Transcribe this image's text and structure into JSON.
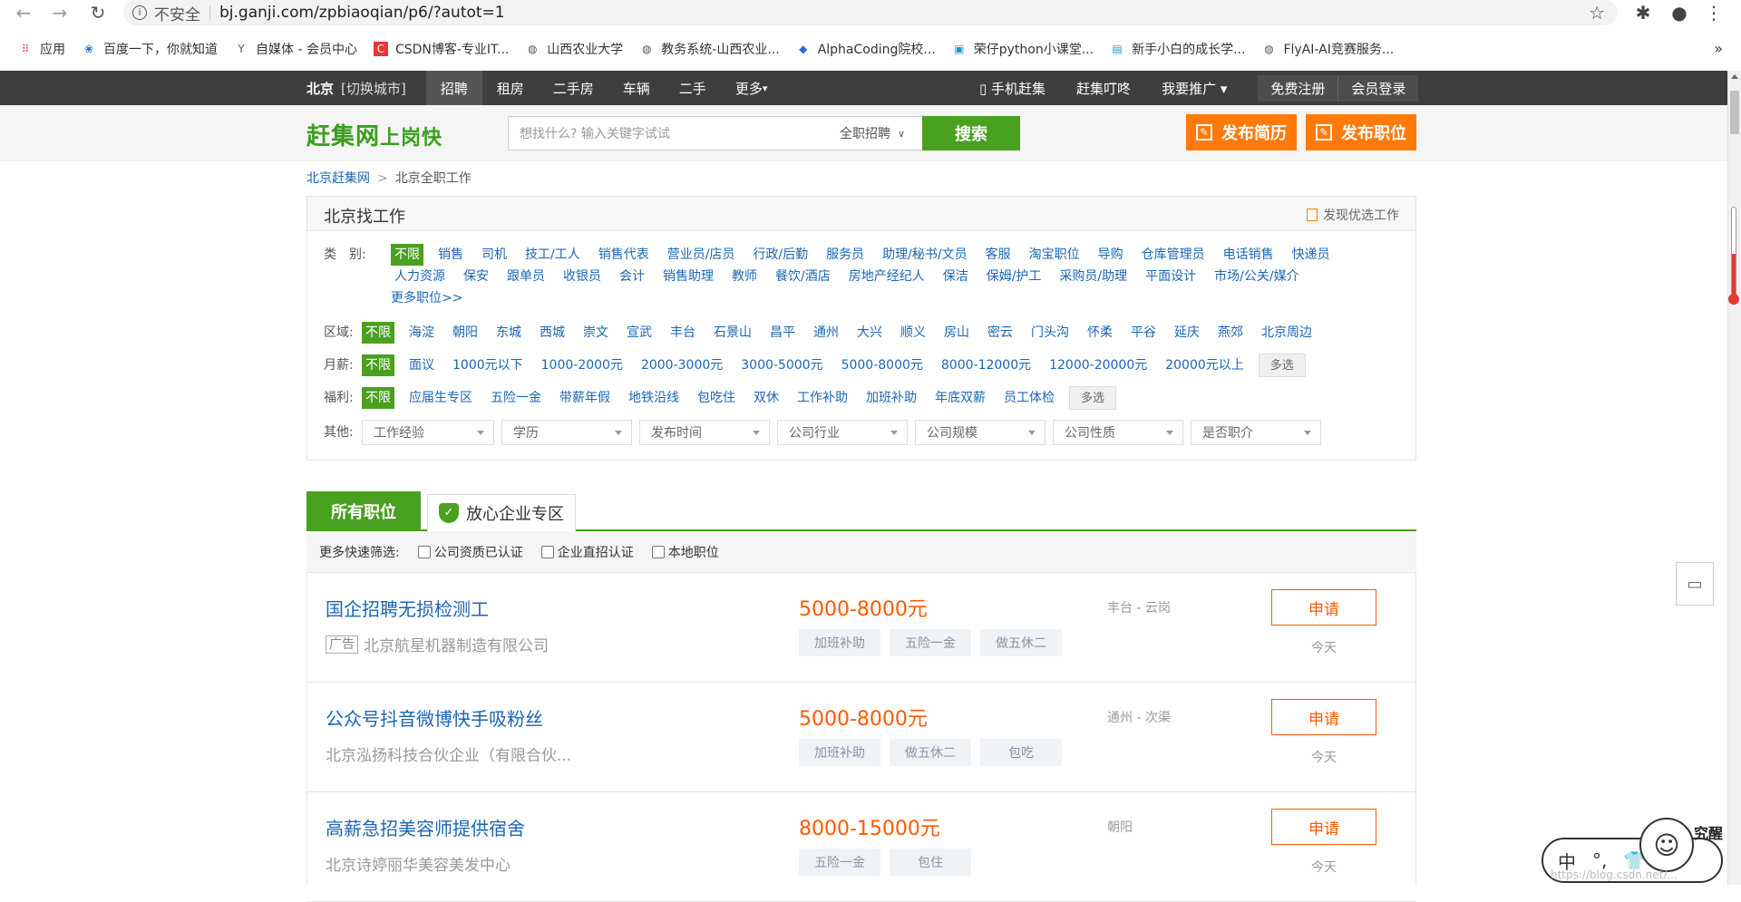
{
  "browser": {
    "security_label": "不安全",
    "url": "bj.ganji.com/zpbiaoqian/p6/?autot=1",
    "bookmarks": [
      {
        "label": "应用",
        "icon": "apps-grid-icon"
      },
      {
        "label": "百度一下，你就知道",
        "icon": "baidu-paw-icon"
      },
      {
        "label": "自媒体 - 会员中心",
        "icon": "media-icon"
      },
      {
        "label": "CSDN博客-专业IT...",
        "icon": "csdn-icon"
      },
      {
        "label": "山西农业大学",
        "icon": "globe-icon"
      },
      {
        "label": "教务系统-山西农业...",
        "icon": "globe-icon"
      },
      {
        "label": "AlphaCoding院校...",
        "icon": "alpha-icon"
      },
      {
        "label": "荣仔python小课堂...",
        "icon": "bilibili-icon"
      },
      {
        "label": "新手小白的成长学...",
        "icon": "board-icon"
      },
      {
        "label": "FlyAI-AI竞赛服务...",
        "icon": "globe-icon"
      }
    ],
    "more_bookmarks": "»"
  },
  "topbar": {
    "city": "北京",
    "switch_city": "[切换城市]",
    "nav": [
      {
        "label": "招聘",
        "active": true
      },
      {
        "label": "租房",
        "active": false
      },
      {
        "label": "二手房",
        "active": false
      },
      {
        "label": "车辆",
        "active": false
      },
      {
        "label": "二手",
        "active": false
      },
      {
        "label": "更多",
        "active": false
      }
    ],
    "mobile": "手机赶集",
    "dingdong": "赶集叮咚",
    "promote": "我要推广",
    "register": "免费注册",
    "login": "会员登录"
  },
  "header": {
    "logo_main": "赶集网",
    "logo_sub": "上岗快",
    "search_placeholder": "想找什么? 输入关键字试试",
    "search_category": "全职招聘",
    "search_button": "搜索",
    "post_resume": "发布简历",
    "post_job": "发布职位"
  },
  "breadcrumb": {
    "home": "北京赶集网",
    "current": "北京全职工作"
  },
  "filter": {
    "title": "北京找工作",
    "preferred": "发现优选工作",
    "category_label": "类　别:",
    "categories": [
      "不限",
      "销售",
      "司机",
      "技工/工人",
      "销售代表",
      "营业员/店员",
      "行政/后勤",
      "服务员",
      "助理/秘书/文员",
      "客服",
      "淘宝职位",
      "导购",
      "仓库管理员",
      "电话销售",
      "快递员",
      "人力资源",
      "保安",
      "跟单员",
      "收银员",
      "会计",
      "销售助理",
      "教师",
      "餐饮/酒店",
      "房地产经纪人",
      "保洁",
      "保姆/护工",
      "采购员/助理",
      "平面设计",
      "市场/公关/媒介"
    ],
    "more_jobs": "更多职位>>",
    "region_label": "区域:",
    "regions": [
      "不限",
      "海淀",
      "朝阳",
      "东城",
      "西城",
      "崇文",
      "宣武",
      "丰台",
      "石景山",
      "昌平",
      "通州",
      "大兴",
      "顺义",
      "房山",
      "密云",
      "门头沟",
      "怀柔",
      "平谷",
      "延庆",
      "燕郊",
      "北京周边"
    ],
    "salary_label": "月薪:",
    "salaries": [
      "不限",
      "面议",
      "1000元以下",
      "1000-2000元",
      "2000-3000元",
      "3000-5000元",
      "5000-8000元",
      "8000-12000元",
      "12000-20000元",
      "20000元以上"
    ],
    "welfare_label": "福利:",
    "welfare": [
      "不限",
      "应届生专区",
      "五险一金",
      "带薪年假",
      "地铁沿线",
      "包吃住",
      "双休",
      "工作补助",
      "加班补助",
      "年底双薪",
      "员工体检"
    ],
    "multi_select": "多选",
    "other_label": "其他:",
    "others": [
      "工作经验",
      "学历",
      "发布时间",
      "公司行业",
      "公司规模",
      "公司性质",
      "是否职介"
    ]
  },
  "tabs": {
    "all": "所有职位",
    "trusted": "放心企业专区"
  },
  "quick_filter": {
    "label": "更多快速筛选:",
    "options": [
      "公司资质已认证",
      "企业直招认证",
      "本地职位"
    ]
  },
  "jobs": [
    {
      "title": "国企招聘无损检测工",
      "ad": "广告",
      "company": "北京航星机器制造有限公司",
      "salary": "5000-8000元",
      "tags": [
        "加班补助",
        "五险一金",
        "做五休二"
      ],
      "location": "丰台 - 云岗",
      "apply": "申请",
      "date": "今天"
    },
    {
      "title": "公众号抖音微博快手吸粉丝",
      "ad": "",
      "company": "北京泓扬科技合伙企业（有限合伙...",
      "salary": "5000-8000元",
      "tags": [
        "加班补助",
        "做五休二",
        "包吃"
      ],
      "location": "通州 - 次渠",
      "apply": "申请",
      "date": "今天"
    },
    {
      "title": "高薪急招美容师提供宿舍",
      "ad": "",
      "company": "北京诗婷丽华美容美发中心",
      "salary": "8000-15000元",
      "tags": [
        "五险一金",
        "包住"
      ],
      "location": "朝阳",
      "apply": "申请",
      "date": "今天"
    }
  ],
  "ime": {
    "chars": [
      "中",
      "°,",
      "👕"
    ]
  },
  "mascot_label": "究醒",
  "watermark": "https://blog.csdn.net/..."
}
